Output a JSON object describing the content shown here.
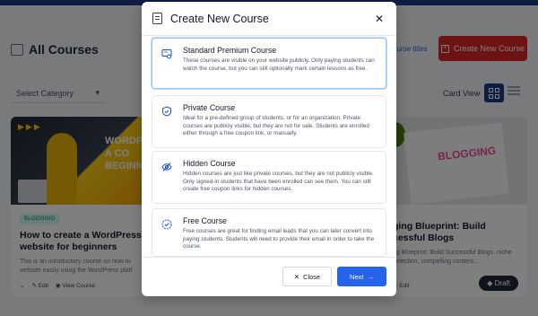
{
  "page": {
    "title": "All Courses",
    "search_titles_link": "ourse titles",
    "create_button_label": "Create New Course",
    "select_category_label": "Select Category",
    "card_view_label": "Card View"
  },
  "cards": [
    {
      "thumb_text_1": "WORDPR",
      "thumb_text_2": "A CO",
      "thumb_text_3": "BEGINNER",
      "tag": "BLOGGING",
      "title": "How to create a WordPress website for beginners",
      "desc": "This is an introductory course on how to website easily using the WordPress platf",
      "edit_label": "Edit",
      "view_label": "View Course"
    },
    {
      "thumb_text_1": "BLOGGING",
      "title": "ging Blueprint: Build cessful Blogs",
      "desc": "ng Blueprint: Build Successful Blogs. niche selection, compelling content...",
      "edit_label": "Edit",
      "status": "Draft"
    }
  ],
  "modal": {
    "title": "Create New Course",
    "options": [
      {
        "title": "Standard Premium Course",
        "desc": "These courses are visible on your website publicly. Only paying students can watch the course, but you can still optionally mark certain lessons as free.",
        "icon": "premium-course-icon",
        "selected": true
      },
      {
        "title": "Private Course",
        "desc": "Ideal for a pre-defined group of students, or for an organization. Private courses are publicly visible, but they are not for sale. Students are enrolled either through a free coupon link, or manually.",
        "icon": "shield-icon",
        "selected": false
      },
      {
        "title": "Hidden Course",
        "desc": "Hidden courses are just like private courses, but they are not publicly visible. Only signed-in students that have been enrolled can see them. You can still create free coupon links for hidden courses.",
        "icon": "eye-slash-icon",
        "selected": false
      },
      {
        "title": "Free Course",
        "desc": "Free courses are great for finding email leads that you can later convert into paying students. Students will need to provide their email in order to take the course.",
        "icon": "check-circle-icon",
        "selected": false
      }
    ],
    "close_label": "Close",
    "next_label": "Next"
  },
  "colors": {
    "accent": "#2563eb",
    "create_button": "#dc2626",
    "nav": "#1e3a8a"
  }
}
